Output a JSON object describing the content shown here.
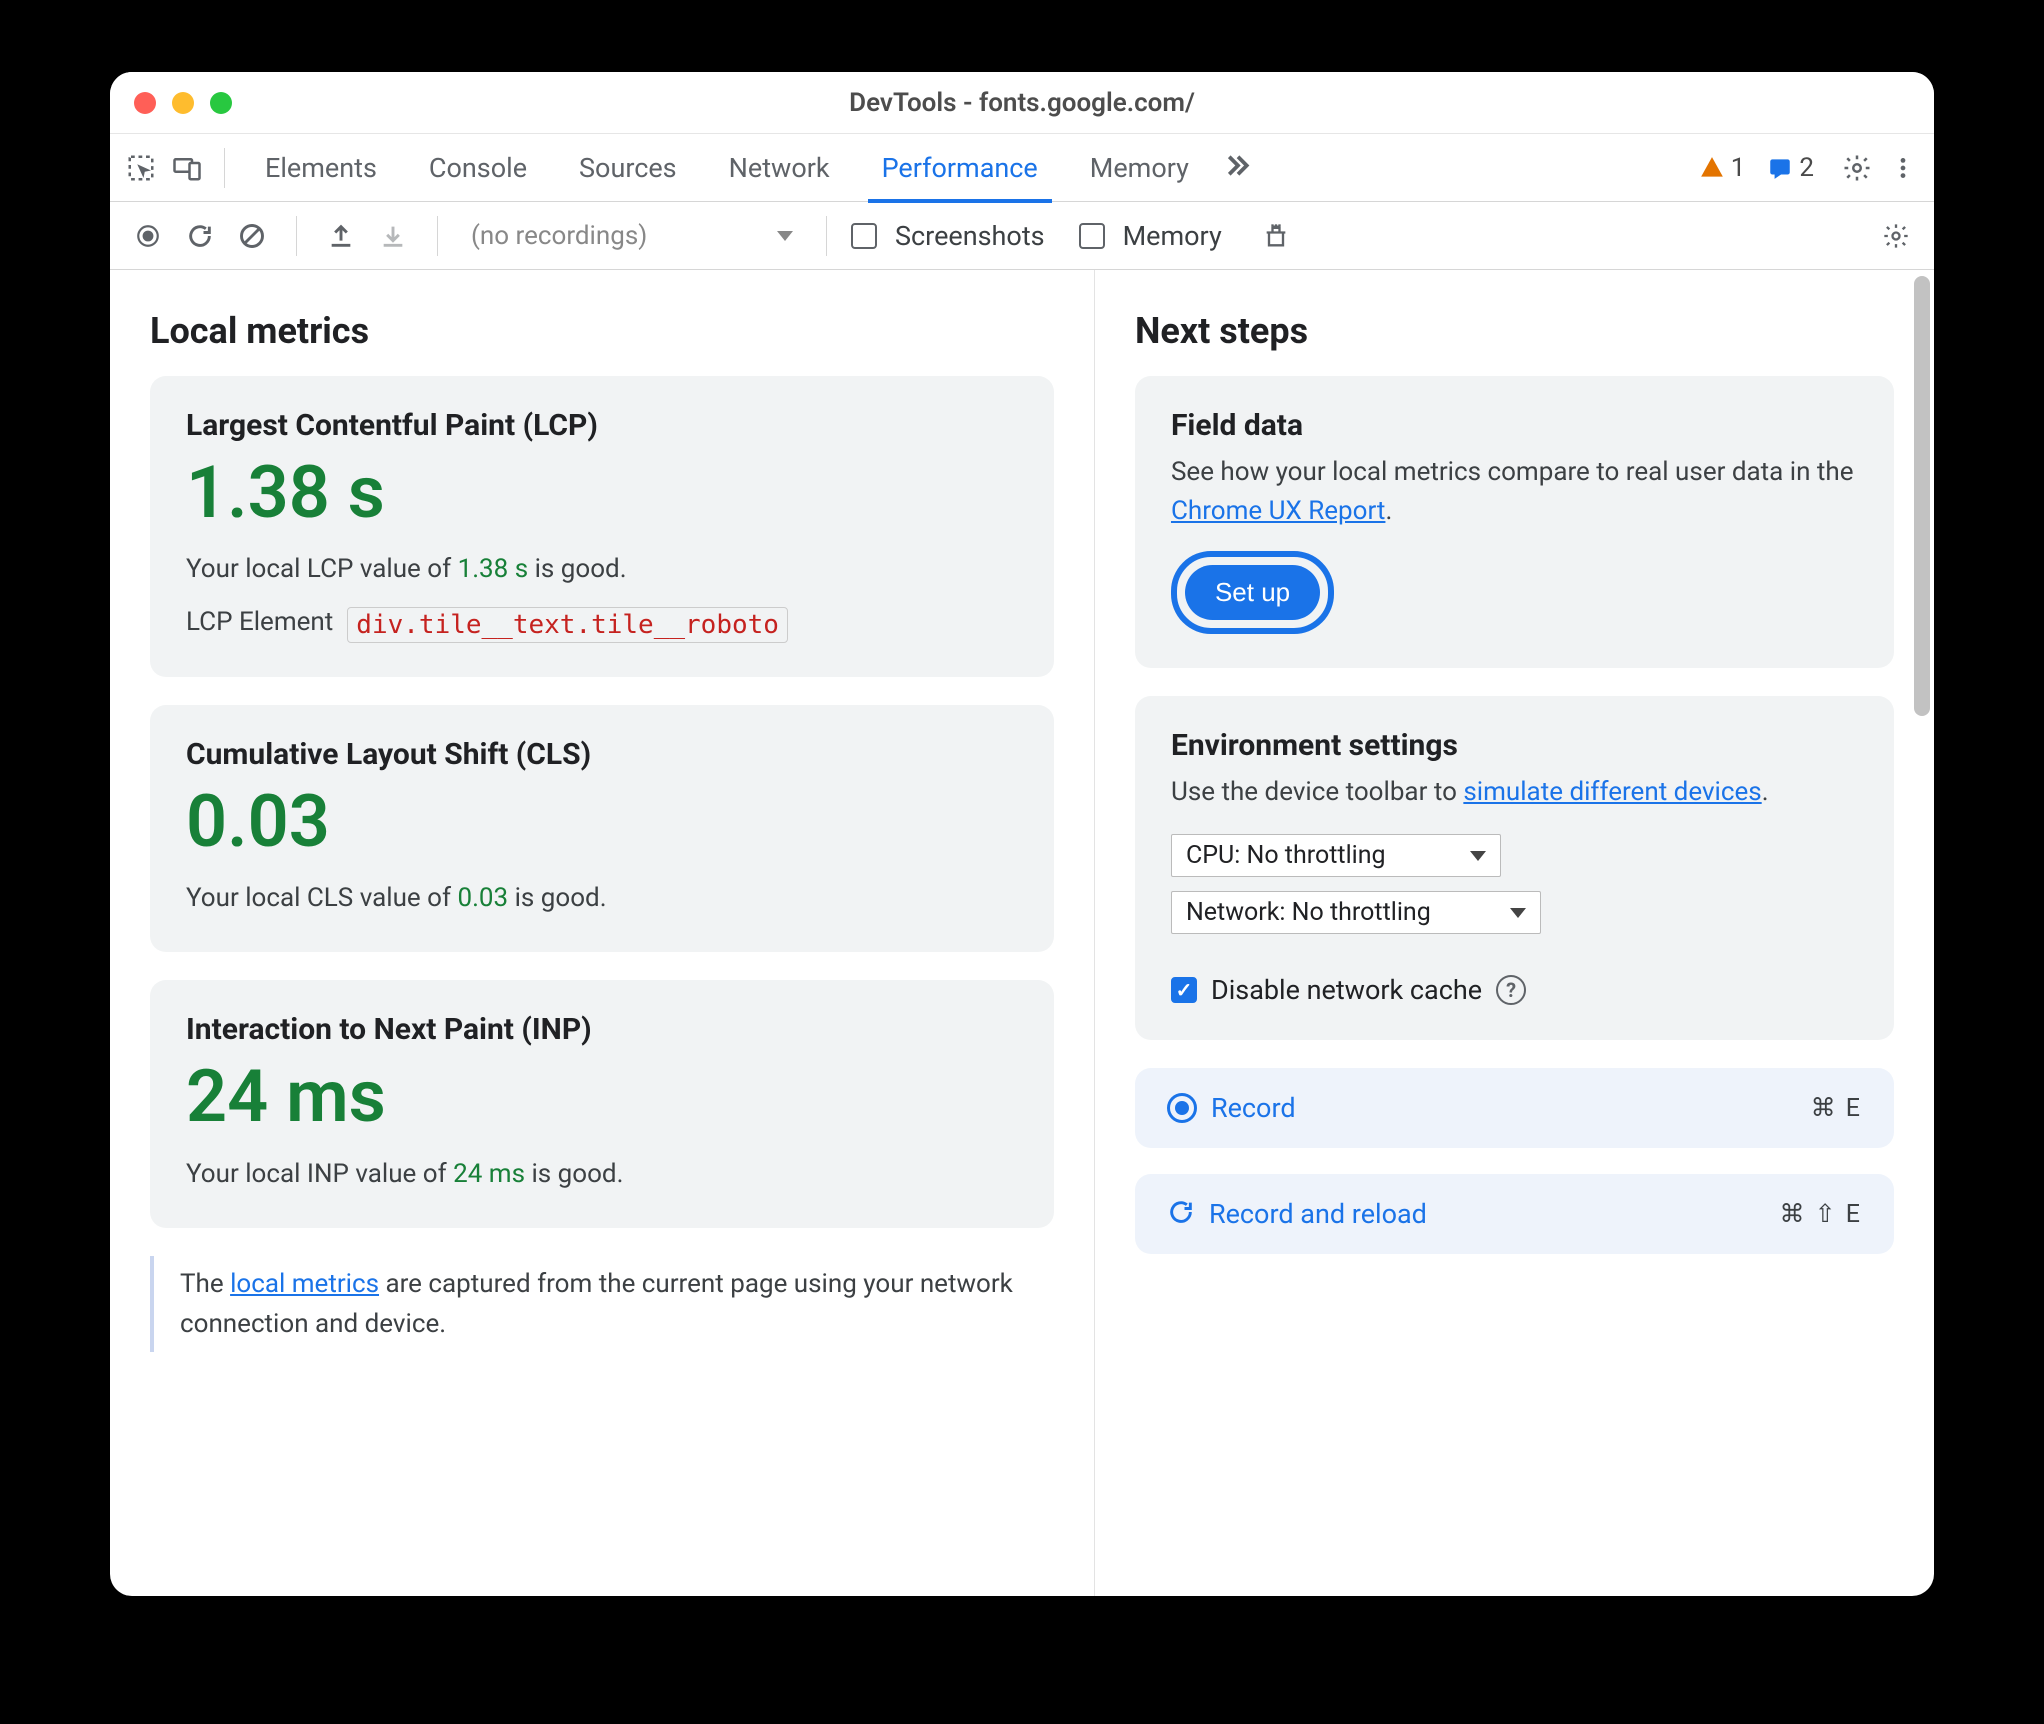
{
  "window": {
    "title": "DevTools - fonts.google.com/"
  },
  "tabs": {
    "elements": "Elements",
    "console": "Console",
    "sources": "Sources",
    "network": "Network",
    "performance": "Performance",
    "memory": "Memory"
  },
  "badges": {
    "warning_count": "1",
    "info_count": "2"
  },
  "toolbar2": {
    "recordings_placeholder": "(no recordings)",
    "screenshots": "Screenshots",
    "memory": "Memory"
  },
  "local": {
    "heading": "Local metrics",
    "lcp": {
      "title": "Largest Contentful Paint (LCP)",
      "value": "1.38 s",
      "desc_pre": "Your local LCP value of ",
      "desc_val": "1.38 s",
      "desc_post": " is good.",
      "el_label": "LCP Element",
      "el_value": "div.tile__text.tile__roboto"
    },
    "cls": {
      "title": "Cumulative Layout Shift (CLS)",
      "value": "0.03",
      "desc_pre": "Your local CLS value of ",
      "desc_val": "0.03",
      "desc_post": " is good."
    },
    "inp": {
      "title": "Interaction to Next Paint (INP)",
      "value": "24 ms",
      "desc_pre": "Your local INP value of ",
      "desc_val": "24 ms",
      "desc_post": " is good."
    },
    "note_pre": "The ",
    "note_link": "local metrics",
    "note_post": " are captured from the current page using your network connection and device."
  },
  "next": {
    "heading": "Next steps",
    "field": {
      "title": "Field data",
      "desc_pre": "See how your local metrics compare to real user data in the ",
      "desc_link": "Chrome UX Report",
      "desc_post": ".",
      "button": "Set up"
    },
    "env": {
      "title": "Environment settings",
      "desc_pre": "Use the device toolbar to ",
      "desc_link": "simulate different devices",
      "desc_post": ".",
      "cpu": "CPU: No throttling",
      "network": "Network: No throttling",
      "disable_cache": "Disable network cache"
    },
    "record": {
      "label": "Record",
      "shortcut": "⌘ E"
    },
    "record_reload": {
      "label": "Record and reload",
      "shortcut": "⌘ ⇧ E"
    }
  }
}
